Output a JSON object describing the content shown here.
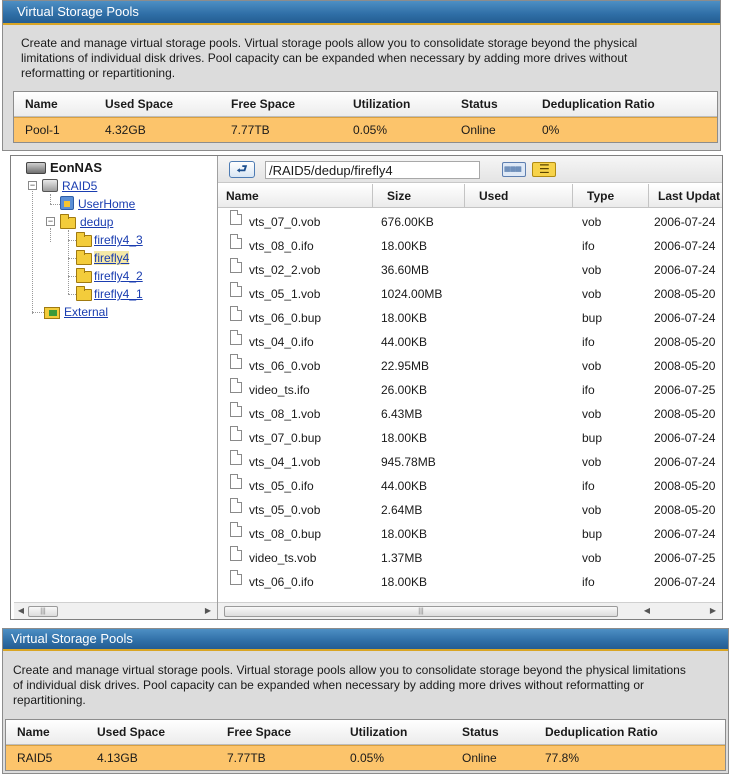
{
  "top_panel": {
    "title": "Virtual Storage Pools",
    "desc_lines": [
      "Create and manage virtual storage pools. Virtual storage pools allow you to consolidate storage beyond the physical",
      "limitations of individual disk drives. Pool capacity can be expanded when necessary by adding more drives without",
      "reformatting or repartitioning."
    ],
    "columns": [
      "Name",
      "Used Space",
      "Free Space",
      "Utilization",
      "Status",
      "Deduplication Ratio"
    ],
    "row": [
      "Pool-1",
      "4.32GB",
      "7.77TB",
      "0.05%",
      "Online",
      "0%"
    ]
  },
  "tree": {
    "root": "EonNAS",
    "raid": "RAID5",
    "userhome": "UserHome",
    "dedup": "dedup",
    "children": [
      "firefly4_3",
      "firefly4",
      "firefly4_2",
      "firefly4_1"
    ],
    "external": "External"
  },
  "toolbar": {
    "back_icon": "back-arrow-icon",
    "path": "/RAID5/dedup/firefly4"
  },
  "file_columns": [
    "Name",
    "Size",
    "Used",
    "Type",
    "Last Updat"
  ],
  "files": [
    {
      "name": "vts_07_0.vob",
      "size": "676.00KB",
      "type": "vob",
      "updated": "2006-07-24"
    },
    {
      "name": "vts_08_0.ifo",
      "size": "18.00KB",
      "type": "ifo",
      "updated": "2006-07-24"
    },
    {
      "name": "vts_02_2.vob",
      "size": "36.60MB",
      "type": "vob",
      "updated": "2006-07-24"
    },
    {
      "name": "vts_05_1.vob",
      "size": "1024.00MB",
      "type": "vob",
      "updated": "2008-05-20"
    },
    {
      "name": "vts_06_0.bup",
      "size": "18.00KB",
      "type": "bup",
      "updated": "2006-07-24"
    },
    {
      "name": "vts_04_0.ifo",
      "size": "44.00KB",
      "type": "ifo",
      "updated": "2008-05-20"
    },
    {
      "name": "vts_06_0.vob",
      "size": "22.95MB",
      "type": "vob",
      "updated": "2008-05-20"
    },
    {
      "name": "video_ts.ifo",
      "size": "26.00KB",
      "type": "ifo",
      "updated": "2006-07-25"
    },
    {
      "name": "vts_08_1.vob",
      "size": "6.43MB",
      "type": "vob",
      "updated": "2008-05-20"
    },
    {
      "name": "vts_07_0.bup",
      "size": "18.00KB",
      "type": "bup",
      "updated": "2006-07-24"
    },
    {
      "name": "vts_04_1.vob",
      "size": "945.78MB",
      "type": "vob",
      "updated": "2006-07-24"
    },
    {
      "name": "vts_05_0.ifo",
      "size": "44.00KB",
      "type": "ifo",
      "updated": "2008-05-20"
    },
    {
      "name": "vts_05_0.vob",
      "size": "2.64MB",
      "type": "vob",
      "updated": "2008-05-20"
    },
    {
      "name": "vts_08_0.bup",
      "size": "18.00KB",
      "type": "bup",
      "updated": "2006-07-24"
    },
    {
      "name": "video_ts.vob",
      "size": "1.37MB",
      "type": "vob",
      "updated": "2006-07-25"
    },
    {
      "name": "vts_06_0.ifo",
      "size": "18.00KB",
      "type": "ifo",
      "updated": "2006-07-24"
    }
  ],
  "bottom_panel": {
    "title": "Virtual Storage Pools",
    "desc_lines": [
      "Create and manage virtual storage pools. Virtual storage pools allow you to consolidate storage beyond the physical limitations",
      "of individual disk drives. Pool capacity can be expanded when necessary by adding more drives without reformatting or",
      "repartitioning."
    ],
    "columns": [
      "Name",
      "Used Space",
      "Free Space",
      "Utilization",
      "Status",
      "Deduplication Ratio"
    ],
    "row": [
      "RAID5",
      "4.13GB",
      "7.77TB",
      "0.05%",
      "Online",
      "77.8%"
    ]
  }
}
